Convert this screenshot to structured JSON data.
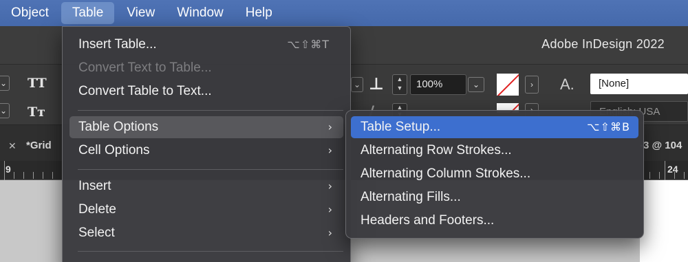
{
  "menubar": {
    "items": [
      "Object",
      "Table",
      "View",
      "Window",
      "Help"
    ],
    "active": "Table"
  },
  "app": {
    "title": "Adobe InDesign 2022"
  },
  "controls": {
    "glyph_tt1": "TT",
    "glyph_tt2": "Tт",
    "scale_value": "100%",
    "paragraph_style": "[None]",
    "language": "English: USA",
    "glyph_a": "A."
  },
  "document": {
    "tab_name": "*Grid",
    "tab_right": "-3 @ 104",
    "ruler_left": "9",
    "ruler_right": "24"
  },
  "table_menu": {
    "items": [
      {
        "label": "Insert Table...",
        "shortcut": "⌥⇧⌘T",
        "enabled": true
      },
      {
        "label": "Convert Text to Table...",
        "enabled": false
      },
      {
        "label": "Convert Table to Text...",
        "enabled": true
      },
      {
        "label": "Table Options",
        "submenu": true,
        "highlighted": true
      },
      {
        "label": "Cell Options",
        "submenu": true
      },
      {
        "label": "Insert",
        "submenu": true
      },
      {
        "label": "Delete",
        "submenu": true
      },
      {
        "label": "Select",
        "submenu": true
      }
    ]
  },
  "table_options_submenu": {
    "items": [
      {
        "label": "Table Setup...",
        "shortcut": "⌥⇧⌘B",
        "selected": true
      },
      {
        "label": "Alternating Row Strokes..."
      },
      {
        "label": "Alternating Column Strokes..."
      },
      {
        "label": "Alternating Fills..."
      },
      {
        "label": "Headers and Footers..."
      }
    ]
  },
  "colors": {
    "menubar": "#4a6eb0",
    "selection": "#3d6fcf",
    "menu_bg": "#3a3a3e"
  }
}
